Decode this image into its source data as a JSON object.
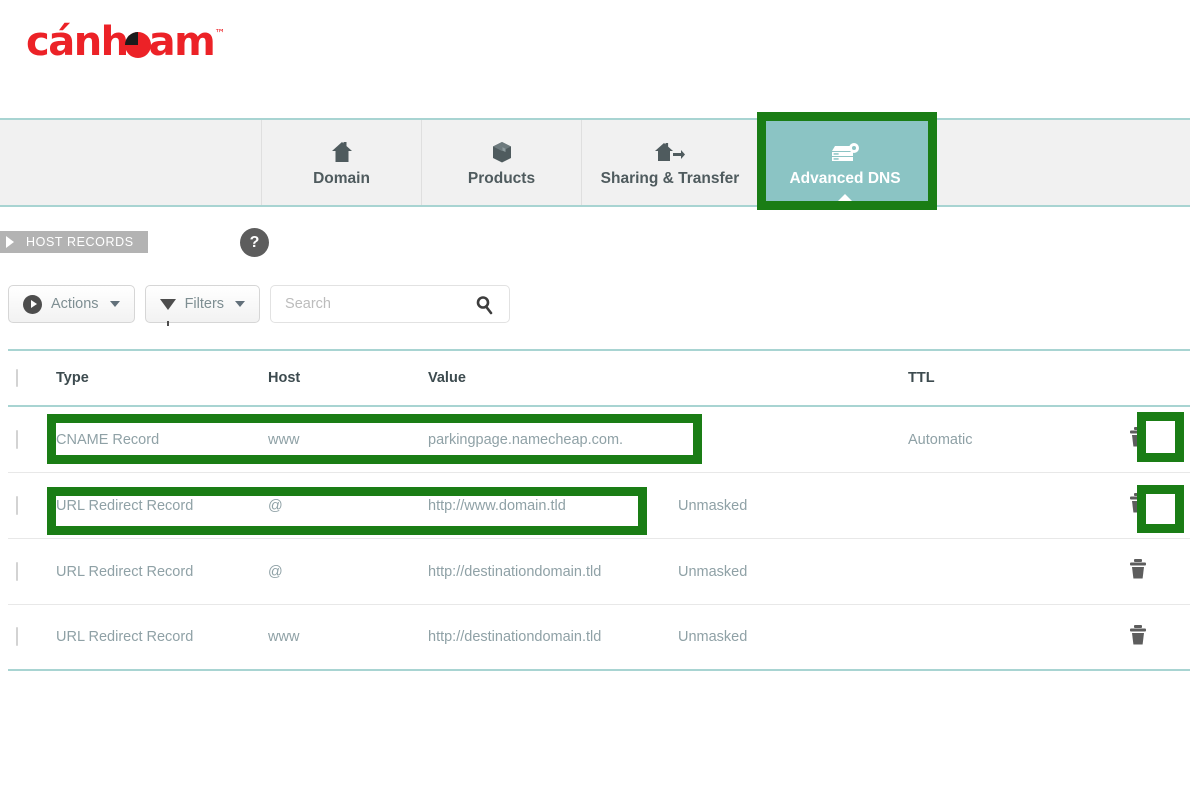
{
  "brand": {
    "name": "cánheam",
    "trademark": "™",
    "color": "#ec2227"
  },
  "tabs": [
    {
      "label": "Domain",
      "icon": "home-icon",
      "active": false
    },
    {
      "label": "Products",
      "icon": "box-icon",
      "active": false
    },
    {
      "label": "Sharing & Transfer",
      "icon": "home-arrow-icon",
      "active": false
    },
    {
      "label": "Advanced DNS",
      "icon": "server-icon",
      "active": true
    }
  ],
  "section": {
    "ribbon_label": "HOST RECORDS",
    "help_label": "?"
  },
  "toolbar": {
    "actions_label": "Actions",
    "filters_label": "Filters",
    "search_placeholder": "Search",
    "search_value": ""
  },
  "table": {
    "columns": [
      "Type",
      "Host",
      "Value",
      "TTL"
    ],
    "rows": [
      {
        "type": "CNAME Record",
        "host": "www",
        "value": "parkingpage.namecheap.com.",
        "mask": "",
        "ttl": "Automatic"
      },
      {
        "type": "URL Redirect Record",
        "host": "@",
        "value": "http://www.domain.tld",
        "mask": "Unmasked",
        "ttl": ""
      },
      {
        "type": "URL Redirect Record",
        "host": "@",
        "value": "http://destinationdomain.tld",
        "mask": "Unmasked",
        "ttl": ""
      },
      {
        "type": "URL Redirect Record",
        "host": "www",
        "value": "http://destinationdomain.tld",
        "mask": "Unmasked",
        "ttl": ""
      }
    ]
  },
  "colors": {
    "accent_teal": "#8bc4c4",
    "border_teal": "#a8d4d2",
    "highlight_green": "#1a7d15",
    "text_muted": "#8fa1a6"
  }
}
